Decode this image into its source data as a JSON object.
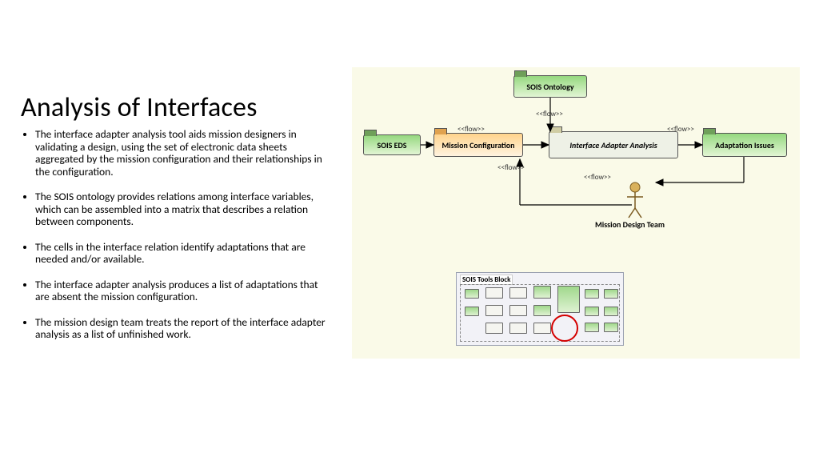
{
  "title": "Analysis of Interfaces",
  "bullets": [
    "The interface adapter analysis tool aids mission designers in validating a design, using the set of electronic data sheets aggregated by the mission configuration and their relationships in the configuration.",
    "The SOIS ontology provides relations among interface variables, which can be assembled into a matrix that describes a relation between components.",
    "The cells in the interface relation identify adaptations that are needed and/or available.",
    "The interface adapter analysis produces a list of adaptations that are absent the mission configuration.",
    "The mission design team treats the report of the interface adapter analysis as a list of unfinished work."
  ],
  "diagram": {
    "sois_ontology": "SOIS Ontology",
    "sois_eds": "SOIS EDS",
    "mission_config": "Mission Configuration",
    "iaa": "Interface Adapter Analysis",
    "adapt_issues": "Adaptation Issues",
    "flow": "<<flow>>",
    "actor": "Mission Design Team",
    "mini_title": "SOIS Tools Block"
  }
}
